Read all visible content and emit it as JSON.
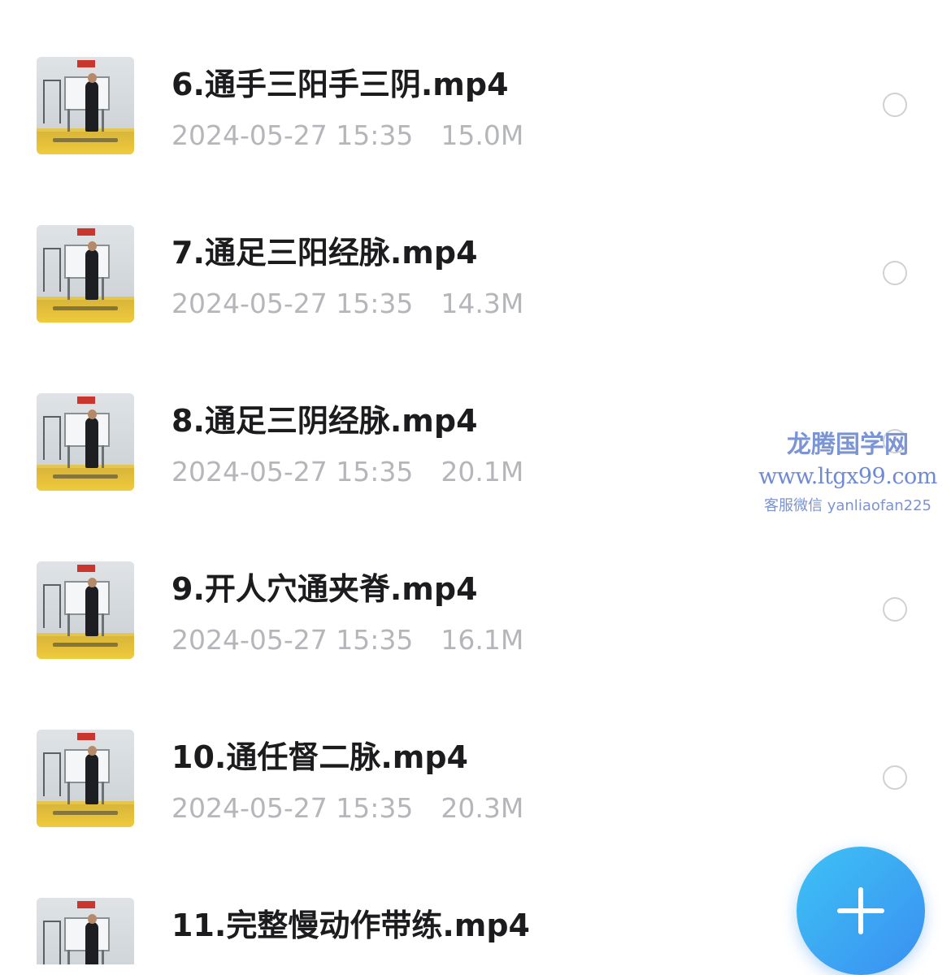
{
  "files": [
    {
      "name": "6.通手三阳手三阴.mp4",
      "date": "2024-05-27 15:35",
      "size": "15.0M"
    },
    {
      "name": "7.通足三阳经脉.mp4",
      "date": "2024-05-27 15:35",
      "size": "14.3M"
    },
    {
      "name": "8.通足三阴经脉.mp4",
      "date": "2024-05-27 15:35",
      "size": "20.1M"
    },
    {
      "name": "9.开人穴通夹脊.mp4",
      "date": "2024-05-27 15:35",
      "size": "16.1M"
    },
    {
      "name": "10.通任督二脉.mp4",
      "date": "2024-05-27 15:35",
      "size": "20.3M"
    },
    {
      "name": "11.完整慢动作带练.mp4"
    }
  ],
  "watermark": {
    "title": "龙腾国学网",
    "url": "www.ltgx99.com",
    "contact": "客服微信 yanliaofan225"
  },
  "fab": {
    "icon": "plus-icon"
  },
  "colors": {
    "fab_start": "#3ec2f5",
    "fab_end": "#3a8ff0",
    "meta_text": "#b4b6ba",
    "title_text": "#1c1c1e",
    "watermark": "#7a94d6"
  }
}
